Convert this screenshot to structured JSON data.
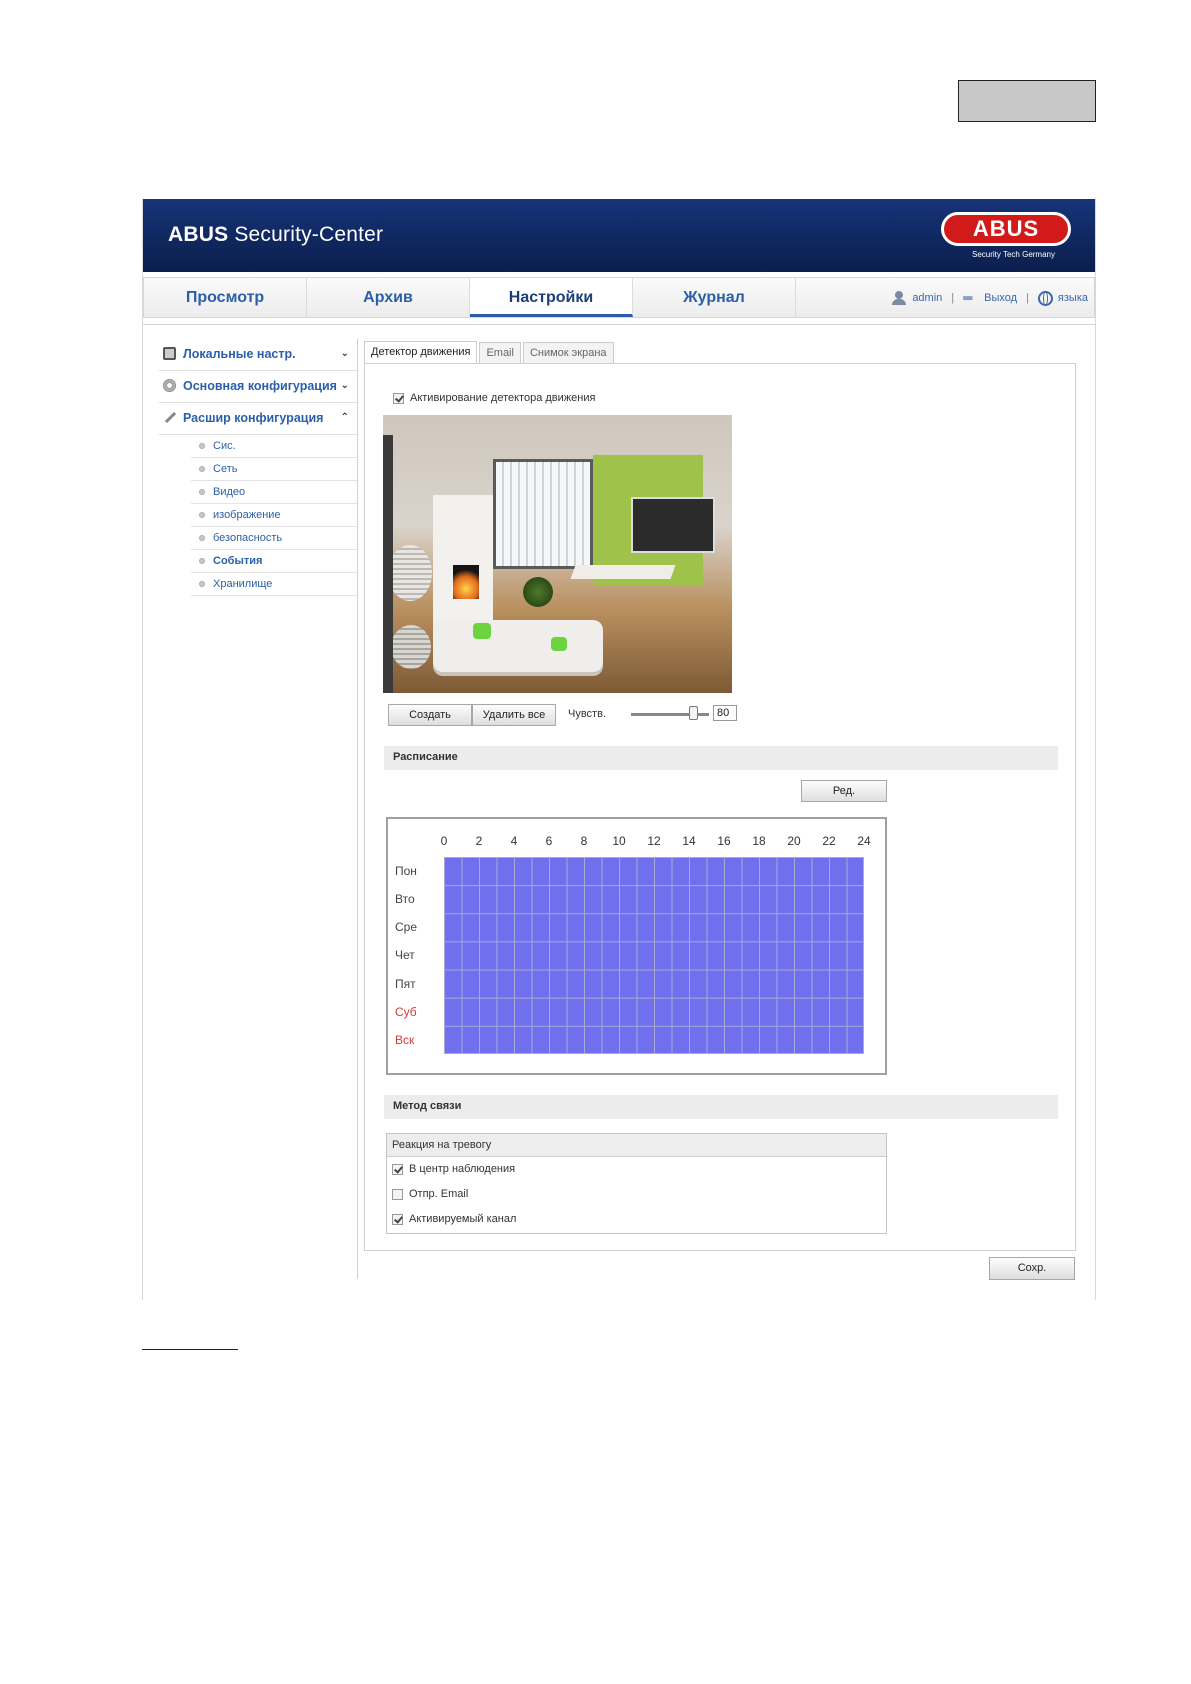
{
  "header": {
    "title_bold": "ABUS",
    "title_rest": " Security-Center",
    "logo_text": "ABUS",
    "logo_tagline": "Security Tech Germany"
  },
  "nav": {
    "tabs": [
      {
        "label": "Просмотр",
        "active": false
      },
      {
        "label": "Архив",
        "active": false
      },
      {
        "label": "Настройки",
        "active": true
      },
      {
        "label": "Журнал",
        "active": false
      }
    ],
    "user": "admin",
    "logout": "Выход",
    "language": "языка"
  },
  "sidebar": {
    "sections": [
      {
        "label": "Локальные настр.",
        "chevron": "⌄"
      },
      {
        "label": "Основная конфигурация",
        "chevron": "⌄"
      },
      {
        "label": "Расшир конфигурация",
        "chevron": "⌃"
      }
    ],
    "items": [
      {
        "label": "Сис."
      },
      {
        "label": "Сеть"
      },
      {
        "label": "Видео"
      },
      {
        "label": "изображение"
      },
      {
        "label": "безопасность"
      },
      {
        "label": "События"
      },
      {
        "label": "Хранилище"
      }
    ]
  },
  "content_tabs": [
    {
      "label": "Детектор движения",
      "active": true
    },
    {
      "label": "Email",
      "active": false
    },
    {
      "label": "Снимок экрана",
      "active": false
    }
  ],
  "motion": {
    "enable_label": "Активирование детектора движения",
    "enable_checked": true,
    "create_button": "Создать",
    "delete_all_button": "Удалить все",
    "sensitivity_label": "Чувств.",
    "sensitivity_value": "80",
    "sensitivity_max": 100
  },
  "schedule": {
    "section_title": "Расписание",
    "edit_button": "Ред.",
    "hours": [
      "0",
      "2",
      "4",
      "6",
      "8",
      "10",
      "12",
      "14",
      "16",
      "18",
      "20",
      "22",
      "24"
    ],
    "days": [
      {
        "label": "Пон",
        "weekend": false
      },
      {
        "label": "Вто",
        "weekend": false
      },
      {
        "label": "Сре",
        "weekend": false
      },
      {
        "label": "Чет",
        "weekend": false
      },
      {
        "label": "Пят",
        "weekend": false
      },
      {
        "label": "Суб",
        "weekend": true
      },
      {
        "label": "Вск",
        "weekend": true
      }
    ],
    "fill_color": "#7070ee",
    "weekend_color": "#d83a3a"
  },
  "linkage": {
    "section_title": "Метод связи",
    "group_title": "Реакция на тревогу",
    "options": [
      {
        "label": "В центр наблюдения",
        "checked": true
      },
      {
        "label": "Отпр. Email",
        "checked": false
      },
      {
        "label": "Активируемый канал",
        "checked": true
      }
    ]
  },
  "save_button": "Сохр."
}
